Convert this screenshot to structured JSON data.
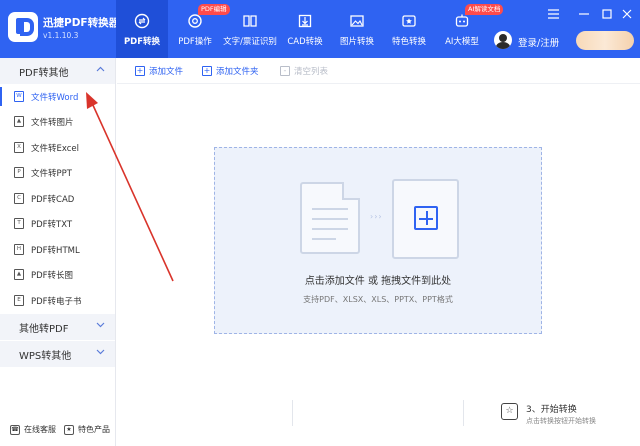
{
  "app": {
    "name": "迅捷PDF转换器",
    "version": "v1.1.10.3"
  },
  "nav": {
    "tabs": [
      {
        "label": "PDF转换",
        "icon": "convert-icon",
        "active": true
      },
      {
        "label": "PDF操作",
        "icon": "gear-icon",
        "badge": "PDF编辑"
      },
      {
        "label": "文字/票证识别",
        "icon": "scan-icon"
      },
      {
        "label": "CAD转换",
        "icon": "cad-icon"
      },
      {
        "label": "图片转换",
        "icon": "image-icon"
      },
      {
        "label": "特色转换",
        "icon": "star-icon"
      },
      {
        "label": "AI大模型",
        "icon": "ai-icon",
        "badge": "AI解读文档"
      }
    ]
  },
  "user": {
    "login_label": "登录/注册"
  },
  "sidebar": {
    "groups": [
      {
        "label": "PDF转其他",
        "expanded": true,
        "items": [
          {
            "label": "文件转Word",
            "icon": "word-icon",
            "active": true
          },
          {
            "label": "文件转图片",
            "icon": "image-file-icon"
          },
          {
            "label": "文件转Excel",
            "icon": "excel-icon"
          },
          {
            "label": "文件转PPT",
            "icon": "ppt-icon"
          },
          {
            "label": "PDF转CAD",
            "icon": "cad-file-icon"
          },
          {
            "label": "PDF转TXT",
            "icon": "txt-icon"
          },
          {
            "label": "PDF转HTML",
            "icon": "html-icon"
          },
          {
            "label": "PDF转长图",
            "icon": "long-image-icon"
          },
          {
            "label": "PDF转电子书",
            "icon": "ebook-icon"
          }
        ]
      },
      {
        "label": "其他转PDF",
        "expanded": false
      },
      {
        "label": "WPS转其他",
        "expanded": false
      }
    ],
    "footer": {
      "support_label": "在线客服",
      "featured_label": "特色产品"
    }
  },
  "toolbar": {
    "add_file_label": "添加文件",
    "add_folder_label": "添加文件夹",
    "clear_list_label": "清空列表"
  },
  "dropzone": {
    "title": "点击添加文件 或 拖拽文件到此处",
    "formats": "支持PDF、XLSX、XLS、PPTX、PPT格式"
  },
  "start": {
    "title": "3、开始转换",
    "subtitle": "点击转换按钮开始转换"
  },
  "colors": {
    "primary": "#2f63f2",
    "header_active": "#1f4fd8",
    "badge": "#ff4b4b",
    "annotation_arrow": "#d9342b"
  }
}
